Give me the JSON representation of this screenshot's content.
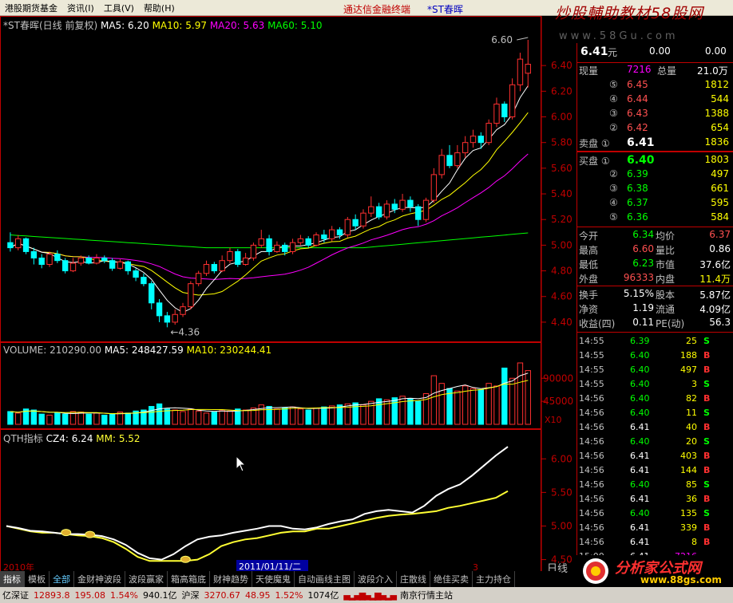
{
  "menu": {
    "items": [
      "港股期货基金",
      "资讯(I)",
      "工具(V)",
      "帮助(H)"
    ],
    "center_red": "通达信金融终端",
    "center_blue": "*ST春晖"
  },
  "watermark": {
    "top": "炒股輔助教材58股网",
    "sub": "www.58Gu.com"
  },
  "price_panel": {
    "title": "*ST春晖(日线 前复权)",
    "ma5": "MA5: 6.20",
    "ma10": "MA10: 5.97",
    "ma20": "MA20: 5.63",
    "ma60": "MA60: 5.10",
    "high_label": "6.60",
    "low_label": "4.36",
    "y_ticks": [
      "6.40",
      "6.20",
      "6.00",
      "5.80",
      "5.60",
      "5.40",
      "5.20",
      "5.00",
      "4.80",
      "4.60",
      "4.40"
    ]
  },
  "volume_panel": {
    "title": "VOLUME: 210290.00",
    "ma5": "MA5: 248427.59",
    "ma10": "MA10: 230244.41",
    "y_ticks": [
      "90000",
      "45000"
    ],
    "y_unit": "X10"
  },
  "qth_panel": {
    "title": "QTH指标",
    "cz4": "CZ4: 6.24",
    "mm": "MM: 5.52",
    "y_ticks": [
      "6.00",
      "5.50",
      "5.00",
      "4.50"
    ]
  },
  "x_axis": {
    "year_label": "2010年",
    "cursor_date": "2011/01/11/二",
    "label3": "3"
  },
  "colors": {
    "ma5": "#ffffff",
    "ma10": "#ffff00",
    "ma20": "#ff00ff",
    "ma60": "#00ff00",
    "up": "#ff3030",
    "down": "#00ffff",
    "cz4": "#ffffff",
    "mm": "#ffff33"
  },
  "quote": {
    "price": "6.41",
    "price_unit": "元",
    "change": "0.00",
    "pct": "0.00",
    "xianliang_label": "现量",
    "xianliang": "7216",
    "zongliang_label": "总量",
    "zongliang": "21.0万",
    "sell": [
      {
        "n": "⑤",
        "p": "6.45",
        "v": "1812"
      },
      {
        "n": "④",
        "p": "6.44",
        "v": "544"
      },
      {
        "n": "③",
        "p": "6.43",
        "v": "1388"
      },
      {
        "n": "②",
        "p": "6.42",
        "v": "654"
      },
      {
        "n": "卖盘 ①",
        "p": "6.41",
        "v": "1836"
      }
    ],
    "buy": [
      {
        "n": "买盘 ①",
        "p": "6.40",
        "v": "1803"
      },
      {
        "n": "②",
        "p": "6.39",
        "v": "497"
      },
      {
        "n": "③",
        "p": "6.38",
        "v": "661"
      },
      {
        "n": "④",
        "p": "6.37",
        "v": "595"
      },
      {
        "n": "⑤",
        "p": "6.36",
        "v": "584"
      }
    ],
    "stats": [
      {
        "l1": "今开",
        "v1": "6.34",
        "l2": "均价",
        "v2": "6.37"
      },
      {
        "l1": "最高",
        "v1": "6.60",
        "l2": "量比",
        "v2": "0.86"
      },
      {
        "l1": "最低",
        "v1": "6.23",
        "l2": "市值",
        "v2": "37.6亿"
      },
      {
        "l1": "外盘",
        "v1": "96333",
        "l2": "内盘",
        "v2": "11.4万"
      },
      {
        "l1": "换手",
        "v1": "5.15%",
        "l2": "股本",
        "v2": "5.87亿"
      },
      {
        "l1": "净资",
        "v1": "1.19",
        "l2": "流通",
        "v2": "4.09亿"
      },
      {
        "l1": "收益(四)",
        "v1": "0.11",
        "l2": "PE(动)",
        "v2": "56.3"
      }
    ]
  },
  "ticks": [
    {
      "t": "14:55",
      "p": "6.39",
      "v": "25",
      "d": "S"
    },
    {
      "t": "14:55",
      "p": "6.40",
      "v": "188",
      "d": "B"
    },
    {
      "t": "14:55",
      "p": "6.40",
      "v": "497",
      "d": "B"
    },
    {
      "t": "14:55",
      "p": "6.40",
      "v": "3",
      "d": "S"
    },
    {
      "t": "14:56",
      "p": "6.40",
      "v": "82",
      "d": "B"
    },
    {
      "t": "14:56",
      "p": "6.40",
      "v": "11",
      "d": "S"
    },
    {
      "t": "14:56",
      "p": "6.41",
      "v": "40",
      "d": "B"
    },
    {
      "t": "14:56",
      "p": "6.40",
      "v": "20",
      "d": "S"
    },
    {
      "t": "14:56",
      "p": "6.41",
      "v": "403",
      "d": "B"
    },
    {
      "t": "14:56",
      "p": "6.41",
      "v": "144",
      "d": "B"
    },
    {
      "t": "14:56",
      "p": "6.40",
      "v": "85",
      "d": "S"
    },
    {
      "t": "14:56",
      "p": "6.41",
      "v": "36",
      "d": "B"
    },
    {
      "t": "14:56",
      "p": "6.40",
      "v": "135",
      "d": "S"
    },
    {
      "t": "14:56",
      "p": "6.41",
      "v": "339",
      "d": "B"
    },
    {
      "t": "14:56",
      "p": "6.41",
      "v": "8",
      "d": "B"
    },
    {
      "t": "15:00",
      "p": "6.41",
      "v": "7216",
      "d": ""
    }
  ],
  "right_bottom": {
    "label": "日线"
  },
  "bottom_tabs": [
    "指标",
    "模板",
    "全部",
    "金财神波段",
    "波段赢家",
    "箱高箱底",
    "财神趋势",
    "天使魔鬼",
    "自动画线主图",
    "波段介入",
    "庄散线",
    "绝佳买卖",
    "主力持仓"
  ],
  "status": {
    "sz": "亿深证",
    "sz_val": "12893.8",
    "sz_chg": "195.08",
    "sz_pct": "1.54%",
    "amt1": "940.1亿",
    "hs": "沪深",
    "hs_val": "3270.67",
    "hs_chg": "48.95",
    "hs_pct": "1.52%",
    "amt2": "1074亿",
    "server": "南京行情主站"
  },
  "logo": {
    "text": "分析家公式网",
    "url": "www.88gs.com"
  },
  "chart_data": {
    "type": "candlestick",
    "series": [
      {
        "o": 5.02,
        "c": 4.98,
        "h": 5.1,
        "l": 4.95
      },
      {
        "o": 4.98,
        "c": 5.05,
        "h": 5.08,
        "l": 4.96
      },
      {
        "o": 5.05,
        "c": 4.95,
        "h": 5.06,
        "l": 4.93
      },
      {
        "o": 4.95,
        "c": 4.9,
        "h": 4.98,
        "l": 4.85
      },
      {
        "o": 4.9,
        "c": 4.85,
        "h": 4.93,
        "l": 4.82
      },
      {
        "o": 4.85,
        "c": 4.93,
        "h": 4.95,
        "l": 4.83
      },
      {
        "o": 4.93,
        "c": 4.88,
        "h": 4.96,
        "l": 4.86
      },
      {
        "o": 4.88,
        "c": 4.8,
        "h": 4.9,
        "l": 4.78
      },
      {
        "o": 4.8,
        "c": 4.86,
        "h": 4.9,
        "l": 4.79
      },
      {
        "o": 4.86,
        "c": 4.9,
        "h": 4.92,
        "l": 4.84
      },
      {
        "o": 4.9,
        "c": 4.86,
        "h": 4.92,
        "l": 4.85
      },
      {
        "o": 4.86,
        "c": 4.9,
        "h": 4.93,
        "l": 4.85
      },
      {
        "o": 4.9,
        "c": 4.88,
        "h": 4.92,
        "l": 4.86
      },
      {
        "o": 4.88,
        "c": 4.82,
        "h": 4.9,
        "l": 4.8
      },
      {
        "o": 4.82,
        "c": 4.87,
        "h": 4.89,
        "l": 4.81
      },
      {
        "o": 4.87,
        "c": 4.8,
        "h": 4.88,
        "l": 4.77
      },
      {
        "o": 4.8,
        "c": 4.75,
        "h": 4.82,
        "l": 4.72
      },
      {
        "o": 4.75,
        "c": 4.7,
        "h": 4.78,
        "l": 4.68
      },
      {
        "o": 4.7,
        "c": 4.55,
        "h": 4.72,
        "l": 4.5
      },
      {
        "o": 4.55,
        "c": 4.45,
        "h": 4.58,
        "l": 4.4
      },
      {
        "o": 4.45,
        "c": 4.4,
        "h": 4.48,
        "l": 4.36
      },
      {
        "o": 4.4,
        "c": 4.46,
        "h": 4.5,
        "l": 4.38
      },
      {
        "o": 4.46,
        "c": 4.52,
        "h": 4.55,
        "l": 4.44
      },
      {
        "o": 4.52,
        "c": 4.7,
        "h": 4.72,
        "l": 4.5
      },
      {
        "o": 4.7,
        "c": 4.78,
        "h": 4.8,
        "l": 4.68
      },
      {
        "o": 4.78,
        "c": 4.85,
        "h": 4.88,
        "l": 4.76
      },
      {
        "o": 4.85,
        "c": 4.8,
        "h": 4.87,
        "l": 4.78
      },
      {
        "o": 4.8,
        "c": 4.88,
        "h": 4.92,
        "l": 4.79
      },
      {
        "o": 4.88,
        "c": 4.95,
        "h": 4.98,
        "l": 4.86
      },
      {
        "o": 4.95,
        "c": 4.85,
        "h": 4.97,
        "l": 4.83
      },
      {
        "o": 4.85,
        "c": 4.9,
        "h": 4.94,
        "l": 4.84
      },
      {
        "o": 4.9,
        "c": 5.0,
        "h": 5.02,
        "l": 4.88
      },
      {
        "o": 5.0,
        "c": 5.05,
        "h": 5.12,
        "l": 4.98
      },
      {
        "o": 5.05,
        "c": 4.95,
        "h": 5.08,
        "l": 4.92
      },
      {
        "o": 4.95,
        "c": 5.0,
        "h": 5.03,
        "l": 4.94
      },
      {
        "o": 5.0,
        "c": 4.95,
        "h": 5.02,
        "l": 4.92
      },
      {
        "o": 4.95,
        "c": 5.02,
        "h": 5.05,
        "l": 4.93
      },
      {
        "o": 5.02,
        "c": 5.05,
        "h": 5.08,
        "l": 5.0
      },
      {
        "o": 5.05,
        "c": 5.0,
        "h": 5.07,
        "l": 4.98
      },
      {
        "o": 5.0,
        "c": 5.08,
        "h": 5.1,
        "l": 4.99
      },
      {
        "o": 5.08,
        "c": 5.05,
        "h": 5.12,
        "l": 5.02
      },
      {
        "o": 5.05,
        "c": 5.12,
        "h": 5.15,
        "l": 5.03
      },
      {
        "o": 5.12,
        "c": 5.08,
        "h": 5.14,
        "l": 5.05
      },
      {
        "o": 5.08,
        "c": 5.2,
        "h": 5.22,
        "l": 5.06
      },
      {
        "o": 5.2,
        "c": 5.15,
        "h": 5.24,
        "l": 5.12
      },
      {
        "o": 5.15,
        "c": 5.25,
        "h": 5.28,
        "l": 5.13
      },
      {
        "o": 5.25,
        "c": 5.3,
        "h": 5.38,
        "l": 5.22
      },
      {
        "o": 5.3,
        "c": 5.22,
        "h": 5.33,
        "l": 5.2
      },
      {
        "o": 5.22,
        "c": 5.32,
        "h": 5.35,
        "l": 5.2
      },
      {
        "o": 5.32,
        "c": 5.28,
        "h": 5.36,
        "l": 5.25
      },
      {
        "o": 5.28,
        "c": 5.35,
        "h": 5.4,
        "l": 5.26
      },
      {
        "o": 5.35,
        "c": 5.3,
        "h": 5.38,
        "l": 5.26
      },
      {
        "o": 5.3,
        "c": 5.2,
        "h": 5.32,
        "l": 5.15
      },
      {
        "o": 5.2,
        "c": 5.35,
        "h": 5.37,
        "l": 5.18
      },
      {
        "o": 5.35,
        "c": 5.55,
        "h": 5.6,
        "l": 5.33
      },
      {
        "o": 5.55,
        "c": 5.7,
        "h": 5.75,
        "l": 5.52
      },
      {
        "o": 5.7,
        "c": 5.62,
        "h": 5.78,
        "l": 5.6
      },
      {
        "o": 5.62,
        "c": 5.72,
        "h": 5.78,
        "l": 5.6
      },
      {
        "o": 5.72,
        "c": 5.8,
        "h": 5.85,
        "l": 5.68
      },
      {
        "o": 5.8,
        "c": 5.85,
        "h": 5.9,
        "l": 5.76
      },
      {
        "o": 5.85,
        "c": 5.8,
        "h": 5.88,
        "l": 5.75
      },
      {
        "o": 5.8,
        "c": 5.95,
        "h": 5.98,
        "l": 5.78
      },
      {
        "o": 5.95,
        "c": 6.1,
        "h": 6.15,
        "l": 5.92
      },
      {
        "o": 6.1,
        "c": 6.0,
        "h": 6.12,
        "l": 5.96
      },
      {
        "o": 6.0,
        "c": 6.25,
        "h": 6.3,
        "l": 5.98
      },
      {
        "o": 6.25,
        "c": 6.45,
        "h": 6.5,
        "l": 6.2
      },
      {
        "o": 6.34,
        "c": 6.41,
        "h": 6.6,
        "l": 6.23
      }
    ],
    "volume": [
      25,
      22,
      30,
      28,
      20,
      18,
      22,
      20,
      25,
      24,
      20,
      22,
      18,
      20,
      24,
      22,
      26,
      28,
      35,
      40,
      30,
      28,
      25,
      30,
      26,
      22,
      24,
      28,
      26,
      30,
      28,
      32,
      38,
      35,
      30,
      32,
      34,
      30,
      28,
      32,
      34,
      36,
      38,
      40,
      42,
      38,
      45,
      50,
      48,
      52,
      55,
      50,
      45,
      60,
      95,
      80,
      70,
      65,
      75,
      70,
      68,
      80,
      75,
      110,
      90,
      120,
      105
    ],
    "cz4": [
      5.0,
      4.97,
      4.93,
      4.92,
      4.9,
      4.88,
      4.88,
      4.87,
      4.85,
      4.8,
      4.72,
      4.6,
      4.52,
      4.5,
      4.58,
      4.7,
      4.8,
      4.84,
      4.86,
      4.9,
      4.93,
      4.96,
      5.0,
      5.0,
      4.96,
      4.95,
      4.98,
      5.03,
      5.07,
      5.1,
      5.18,
      5.22,
      5.24,
      5.22,
      5.2,
      5.3,
      5.45,
      5.55,
      5.62,
      5.75,
      5.9,
      6.05,
      6.18
    ],
    "mm": [
      5.0,
      4.96,
      4.92,
      4.9,
      4.9,
      4.88,
      4.86,
      4.85,
      4.82,
      4.76,
      4.66,
      4.54,
      4.48,
      4.48,
      4.48,
      4.48,
      4.5,
      4.58,
      4.7,
      4.76,
      4.8,
      4.82,
      4.86,
      4.9,
      4.92,
      4.92,
      4.96,
      4.96,
      5.0,
      5.04,
      5.08,
      5.12,
      5.15,
      5.17,
      5.18,
      5.2,
      5.22,
      5.27,
      5.3,
      5.34,
      5.38,
      5.42,
      5.52
    ]
  }
}
